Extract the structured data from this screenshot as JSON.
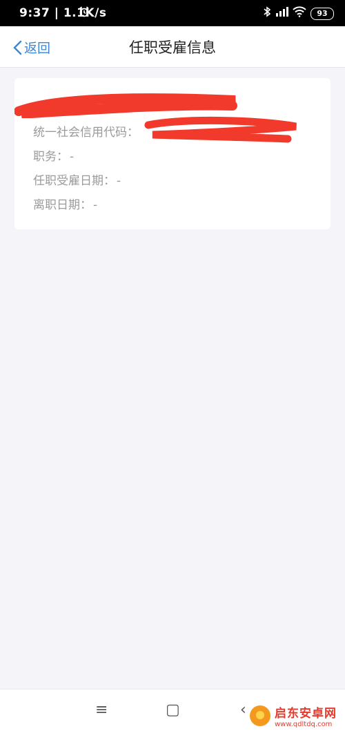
{
  "status_bar": {
    "time": "9:37 | 1.1K/s",
    "battery": "93",
    "icons": [
      "alarm-icon",
      "bluetooth-icon",
      "signal-icon",
      "wifi-icon",
      "battery-icon"
    ]
  },
  "header": {
    "back_label": "返回",
    "title": "任职受雇信息"
  },
  "card": {
    "company_name": "",
    "rows": [
      {
        "label": "统一社会信用代码：",
        "value": ""
      },
      {
        "label": "职务：",
        "value": "-"
      },
      {
        "label": "任职受雇日期：",
        "value": "-"
      },
      {
        "label": "离职日期：",
        "value": "-"
      }
    ]
  },
  "system_nav": {
    "menu": "≡",
    "home": "▢",
    "back": "‹"
  },
  "watermark": {
    "name": "启东安卓网",
    "url": "www.qdltdq.com"
  },
  "colors": {
    "accent": "#3a86d3",
    "redaction": "#f23a2c",
    "background": "#f4f4f9"
  }
}
